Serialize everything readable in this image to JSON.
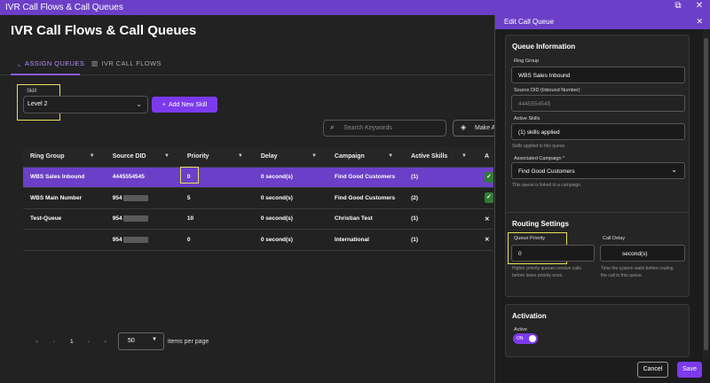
{
  "window": {
    "title": "IVR Call Flows & Call Queues"
  },
  "page": {
    "title": "IVR Call Flows & Call Queues"
  },
  "tabs": [
    {
      "label": "ASSIGN QUEUES",
      "icon": "chart-icon"
    },
    {
      "label": "IVR CALL FLOWS",
      "icon": "bar-chart-icon"
    }
  ],
  "skill": {
    "label": "Skill",
    "value": "Level 2",
    "add_label": "Add New Skill"
  },
  "search": {
    "placeholder": "Search Keywords"
  },
  "make_button": {
    "label": "Make A"
  },
  "table": {
    "headers": [
      "Ring Group",
      "Source DID",
      "Priority",
      "Delay",
      "Campaign",
      "Active Skills",
      "A"
    ],
    "rows": [
      {
        "ring_group": "WBS Sales Inbound",
        "did": "4445554545",
        "priority": "0",
        "delay": "0 second(s)",
        "campaign": "Find Good Customers",
        "skills": "(1)"
      },
      {
        "ring_group": "WBS Main Number",
        "did": "954",
        "priority": "5",
        "delay": "0 second(s)",
        "campaign": "Find Good Customers",
        "skills": "(2)"
      },
      {
        "ring_group": "Test-Queue",
        "did": "954",
        "priority": "10",
        "delay": "0 second(s)",
        "campaign": "Christian Test",
        "skills": "(1)"
      },
      {
        "ring_group": "",
        "did": "954",
        "priority": "0",
        "delay": "0 second(s)",
        "campaign": "International",
        "skills": "(1)"
      }
    ]
  },
  "pager": {
    "page": "1",
    "per_page": "50",
    "per_page_label": "items per page"
  },
  "panel": {
    "title": "Edit Call Queue",
    "queue_info": {
      "title": "Queue Information",
      "ring_group_label": "Ring Group",
      "ring_group_value": "WBS Sales Inbound",
      "did_label": "Source DID (Inbound Number)",
      "did_value": "4445554545",
      "skills_label": "Active Skills",
      "skills_value": "(1) skills applied",
      "skills_help": "Skills applied to this queue.",
      "campaign_label": "Associated Campaign *",
      "campaign_value": "Find Good Customers",
      "campaign_help": "This queue is linked to a campaign."
    },
    "routing": {
      "title": "Routing Settings",
      "priority_label": "Queue Priority",
      "priority_value": "0",
      "priority_help_1": "Higher priority queues receive calls",
      "priority_help_2": "before lower priority ones.",
      "delay_label": "Call Delay",
      "delay_value": "second(s)",
      "delay_help_1": "Time the system waits before routing",
      "delay_help_2": "the call to this queue."
    },
    "activation": {
      "title": "Activation",
      "active_label": "Active",
      "toggle_label": "ON"
    },
    "cancel_label": "Cancel",
    "save_label": "Save"
  }
}
